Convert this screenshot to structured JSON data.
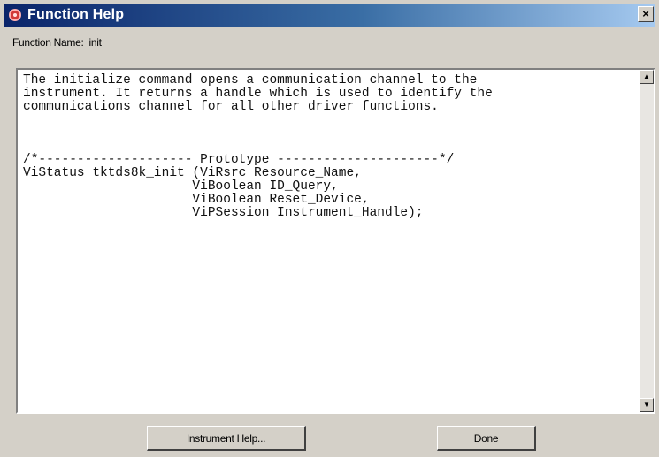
{
  "window": {
    "title": "Function Help",
    "close_label": "×"
  },
  "function_name": {
    "label": "Function Name:",
    "value": "init"
  },
  "help_text": "The initialize command opens a communication channel to the\ninstrument. It returns a handle which is used to identify the\ncommunications channel for all other driver functions.\n\n\n\n/*-------------------- Prototype ---------------------*/\nViStatus tktds8k_init (ViRsrc Resource_Name,\n                      ViBoolean ID_Query,\n                      ViBoolean Reset_Device,\n                      ViPSession Instrument_Handle);",
  "scrollbar": {
    "up_icon": "▲",
    "down_icon": "▼"
  },
  "buttons": {
    "instrument_help": "Instrument Help...",
    "done": "Done"
  },
  "colors": {
    "titlebar_start": "#0a246a",
    "titlebar_end": "#a6caf0",
    "window_bg": "#d4d0c8"
  }
}
